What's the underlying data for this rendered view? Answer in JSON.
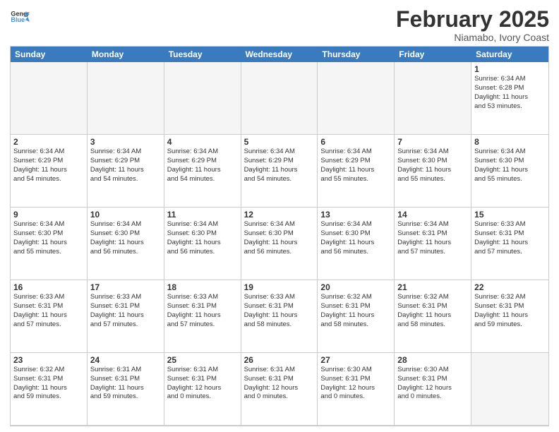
{
  "app": {
    "name": "GeneralBlue",
    "logo_alt": "GeneralBlue logo"
  },
  "calendar": {
    "month_title": "February 2025",
    "subtitle": "Niamabo, Ivory Coast",
    "day_headers": [
      "Sunday",
      "Monday",
      "Tuesday",
      "Wednesday",
      "Thursday",
      "Friday",
      "Saturday"
    ],
    "cells": [
      {
        "day": "",
        "text": "",
        "empty": true
      },
      {
        "day": "",
        "text": "",
        "empty": true
      },
      {
        "day": "",
        "text": "",
        "empty": true
      },
      {
        "day": "",
        "text": "",
        "empty": true
      },
      {
        "day": "",
        "text": "",
        "empty": true
      },
      {
        "day": "",
        "text": "",
        "empty": true
      },
      {
        "day": "1",
        "text": "Sunrise: 6:34 AM\nSunset: 6:28 PM\nDaylight: 11 hours\nand 53 minutes."
      },
      {
        "day": "2",
        "text": "Sunrise: 6:34 AM\nSunset: 6:29 PM\nDaylight: 11 hours\nand 54 minutes."
      },
      {
        "day": "3",
        "text": "Sunrise: 6:34 AM\nSunset: 6:29 PM\nDaylight: 11 hours\nand 54 minutes."
      },
      {
        "day": "4",
        "text": "Sunrise: 6:34 AM\nSunset: 6:29 PM\nDaylight: 11 hours\nand 54 minutes."
      },
      {
        "day": "5",
        "text": "Sunrise: 6:34 AM\nSunset: 6:29 PM\nDaylight: 11 hours\nand 54 minutes."
      },
      {
        "day": "6",
        "text": "Sunrise: 6:34 AM\nSunset: 6:29 PM\nDaylight: 11 hours\nand 55 minutes."
      },
      {
        "day": "7",
        "text": "Sunrise: 6:34 AM\nSunset: 6:30 PM\nDaylight: 11 hours\nand 55 minutes."
      },
      {
        "day": "8",
        "text": "Sunrise: 6:34 AM\nSunset: 6:30 PM\nDaylight: 11 hours\nand 55 minutes."
      },
      {
        "day": "9",
        "text": "Sunrise: 6:34 AM\nSunset: 6:30 PM\nDaylight: 11 hours\nand 55 minutes."
      },
      {
        "day": "10",
        "text": "Sunrise: 6:34 AM\nSunset: 6:30 PM\nDaylight: 11 hours\nand 56 minutes."
      },
      {
        "day": "11",
        "text": "Sunrise: 6:34 AM\nSunset: 6:30 PM\nDaylight: 11 hours\nand 56 minutes."
      },
      {
        "day": "12",
        "text": "Sunrise: 6:34 AM\nSunset: 6:30 PM\nDaylight: 11 hours\nand 56 minutes."
      },
      {
        "day": "13",
        "text": "Sunrise: 6:34 AM\nSunset: 6:30 PM\nDaylight: 11 hours\nand 56 minutes."
      },
      {
        "day": "14",
        "text": "Sunrise: 6:34 AM\nSunset: 6:31 PM\nDaylight: 11 hours\nand 57 minutes."
      },
      {
        "day": "15",
        "text": "Sunrise: 6:33 AM\nSunset: 6:31 PM\nDaylight: 11 hours\nand 57 minutes."
      },
      {
        "day": "16",
        "text": "Sunrise: 6:33 AM\nSunset: 6:31 PM\nDaylight: 11 hours\nand 57 minutes."
      },
      {
        "day": "17",
        "text": "Sunrise: 6:33 AM\nSunset: 6:31 PM\nDaylight: 11 hours\nand 57 minutes."
      },
      {
        "day": "18",
        "text": "Sunrise: 6:33 AM\nSunset: 6:31 PM\nDaylight: 11 hours\nand 57 minutes."
      },
      {
        "day": "19",
        "text": "Sunrise: 6:33 AM\nSunset: 6:31 PM\nDaylight: 11 hours\nand 58 minutes."
      },
      {
        "day": "20",
        "text": "Sunrise: 6:32 AM\nSunset: 6:31 PM\nDaylight: 11 hours\nand 58 minutes."
      },
      {
        "day": "21",
        "text": "Sunrise: 6:32 AM\nSunset: 6:31 PM\nDaylight: 11 hours\nand 58 minutes."
      },
      {
        "day": "22",
        "text": "Sunrise: 6:32 AM\nSunset: 6:31 PM\nDaylight: 11 hours\nand 59 minutes."
      },
      {
        "day": "23",
        "text": "Sunrise: 6:32 AM\nSunset: 6:31 PM\nDaylight: 11 hours\nand 59 minutes."
      },
      {
        "day": "24",
        "text": "Sunrise: 6:31 AM\nSunset: 6:31 PM\nDaylight: 11 hours\nand 59 minutes."
      },
      {
        "day": "25",
        "text": "Sunrise: 6:31 AM\nSunset: 6:31 PM\nDaylight: 12 hours\nand 0 minutes."
      },
      {
        "day": "26",
        "text": "Sunrise: 6:31 AM\nSunset: 6:31 PM\nDaylight: 12 hours\nand 0 minutes."
      },
      {
        "day": "27",
        "text": "Sunrise: 6:30 AM\nSunset: 6:31 PM\nDaylight: 12 hours\nand 0 minutes."
      },
      {
        "day": "28",
        "text": "Sunrise: 6:30 AM\nSunset: 6:31 PM\nDaylight: 12 hours\nand 0 minutes."
      },
      {
        "day": "",
        "text": "",
        "empty": true
      }
    ]
  }
}
